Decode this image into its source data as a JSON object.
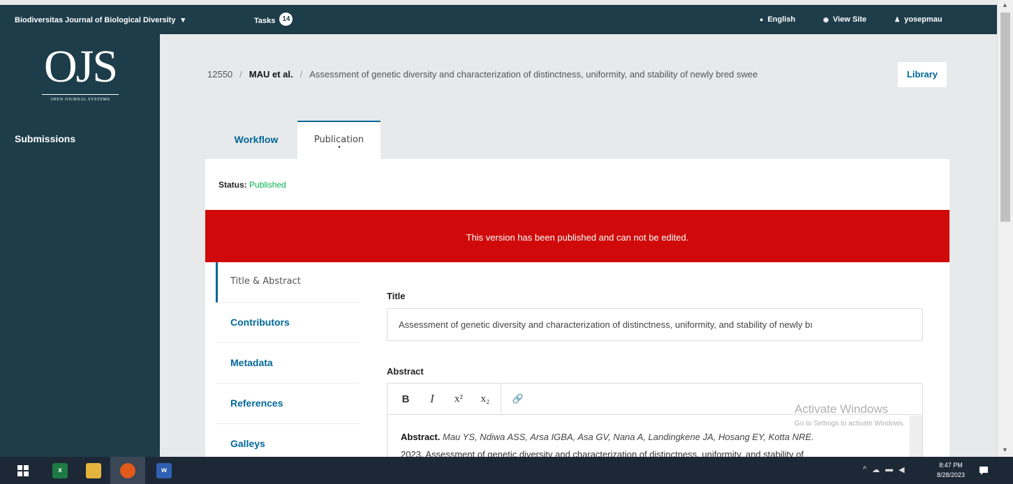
{
  "topbar": {
    "journal": "Biodiversitas Journal of Biological Diversity",
    "tasks_label": "Tasks",
    "tasks_count": "14",
    "language": "English",
    "view_site": "View Site",
    "user": "yosepmau"
  },
  "sidebar": {
    "logo_big": "OJS",
    "logo_small": "OPEN JOURNAL SYSTEMS",
    "nav_submissions": "Submissions"
  },
  "breadcrumb": {
    "id": "12550",
    "author": "MAU et al.",
    "title": "Assessment of genetic diversity and characterization of distinctness, uniformity, and stability of newly bred swee"
  },
  "library_label": "Library",
  "tabs": {
    "workflow": "Workflow",
    "publication": "Publication"
  },
  "status": {
    "label": "Status:",
    "value": "Published",
    "color": "#00b24e"
  },
  "alert": {
    "text": "This version has been published and can not be edited.",
    "color": "#d00a0a"
  },
  "subnav": {
    "title_abstract": "Title & Abstract",
    "contributors": "Contributors",
    "metadata": "Metadata",
    "references": "References",
    "galleys": "Galleys"
  },
  "form": {
    "title_label": "Title",
    "title_value": "Assessment of genetic diversity and characterization of distinctness, uniformity, and stability of newly bı",
    "abstract_label": "Abstract",
    "abstract_bold": "Abstract.",
    "abstract_text": "Mau YS, Ndiwa ASS, Arsa IGBA, Asa GV, Nana A, Landingkene JA, Hosang EY, Kotta NRE.",
    "abstract_line2": "2023. Assessment of genetic diversity and characterization of distinctness, uniformity, and stability of"
  },
  "toolbar": {
    "bold": "B",
    "italic": "I",
    "superscript": "x²",
    "subscript": "x₂",
    "link": "🔗"
  },
  "watermark": {
    "line1": "Activate Windows",
    "line2": "Go to Settings to activate Windows."
  },
  "taskbar": {
    "time": "8:47 PM",
    "date": "8/28/2023"
  },
  "colors": {
    "navy": "#1e3d4a",
    "link": "#006798"
  }
}
